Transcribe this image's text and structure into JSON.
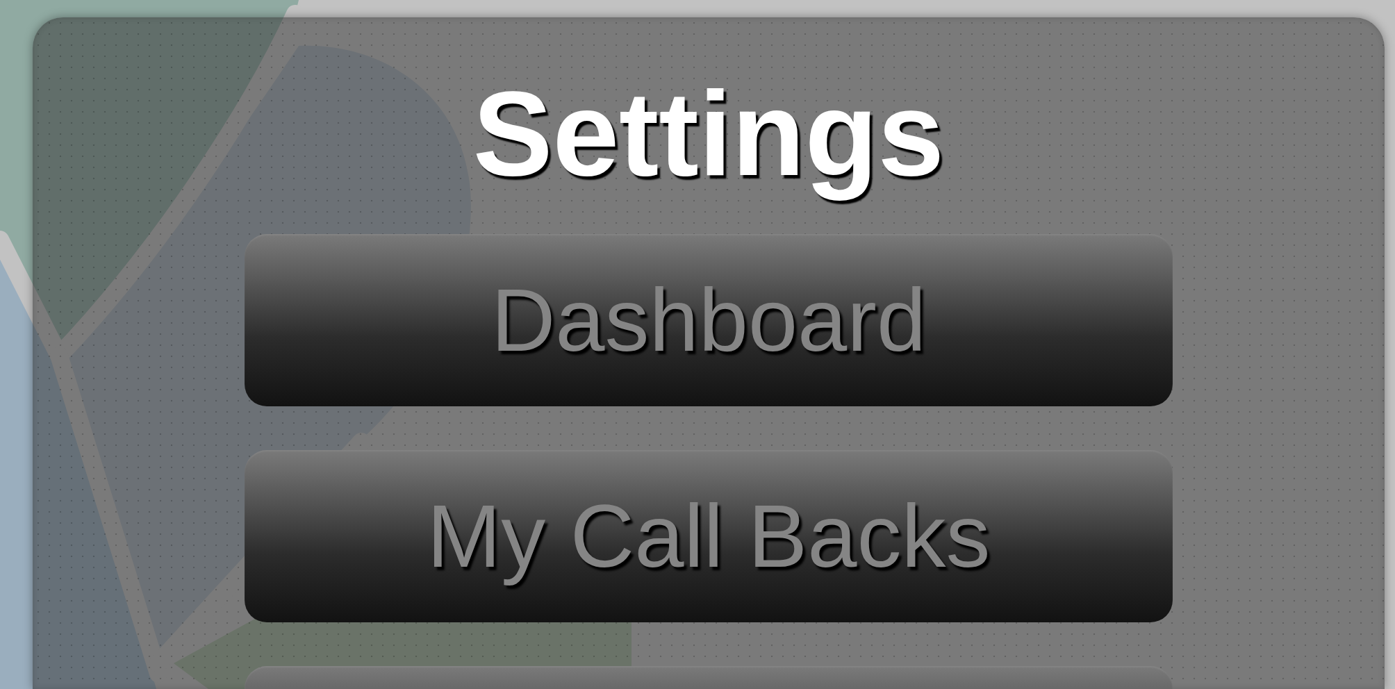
{
  "title": "Settings",
  "buttons": [
    {
      "label": "Dashboard",
      "clipped": false
    },
    {
      "label": "My Call Backs",
      "clipped": false
    },
    {
      "clipped": true
    }
  ]
}
